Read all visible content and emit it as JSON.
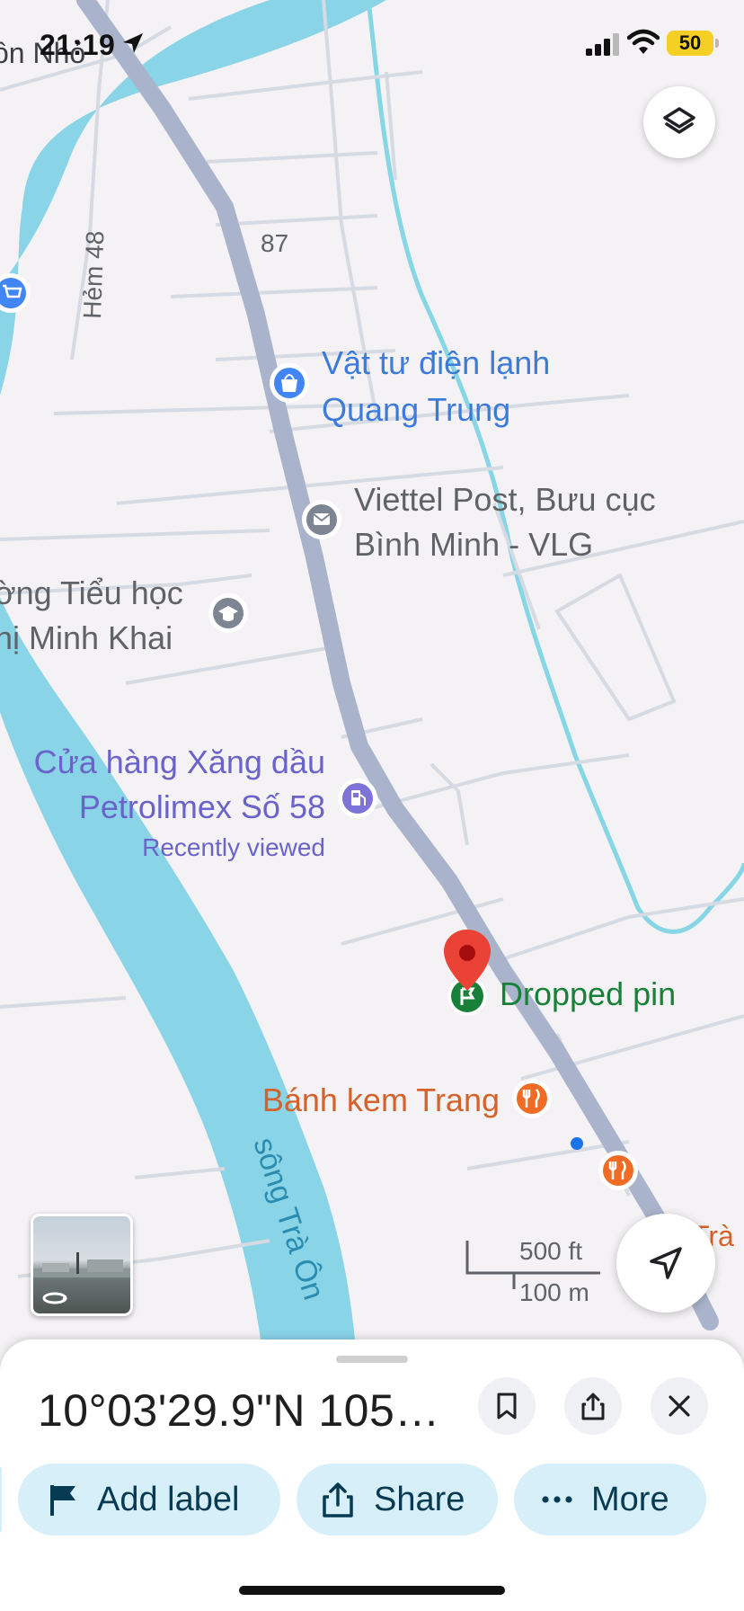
{
  "status_bar": {
    "time": "21:19",
    "battery": "50"
  },
  "map": {
    "labels": {
      "top_left_partial": "ồn Nhỏ",
      "alley": "Hẻm 48",
      "route": "87",
      "shop1_line1": "Vật tư điện lạnh",
      "shop1_line2": "Quang Trung",
      "post_line1": "Viettel Post, Bưu cục",
      "post_line2": "Bình Minh - VLG",
      "school_line1": "ờng Tiểu học",
      "school_line2": "hị Minh Khai",
      "fuel_line1": "Cửa hàng Xăng dầu",
      "fuel_line2": "Petrolimex Số 58",
      "fuel_note": "Recently viewed",
      "pin_label": "Dropped pin",
      "bakery": "Bánh kem Trang",
      "river": "sông Trà Ôn",
      "right_partial": "Trà"
    },
    "scale": {
      "ft": "500 ft",
      "m": "100 m"
    },
    "colors": {
      "water": "#8ad4e8",
      "road": "#a9b4cc",
      "pin": "#ea4335",
      "pin_label": "#188038",
      "poi_blue": "#4285f4",
      "food": "#f06b25"
    }
  },
  "sheet": {
    "coords": "10°03'29.9\"N 105°...",
    "chips": {
      "add_label": "Add label",
      "share": "Share",
      "more": "More"
    }
  },
  "icons": [
    "location-arrow-icon",
    "signal-icon",
    "wifi-icon",
    "layers-icon",
    "streetview-icon",
    "navigate-icon",
    "bookmark-icon",
    "share-icon",
    "close-icon",
    "flag-icon",
    "more-dots-icon"
  ]
}
